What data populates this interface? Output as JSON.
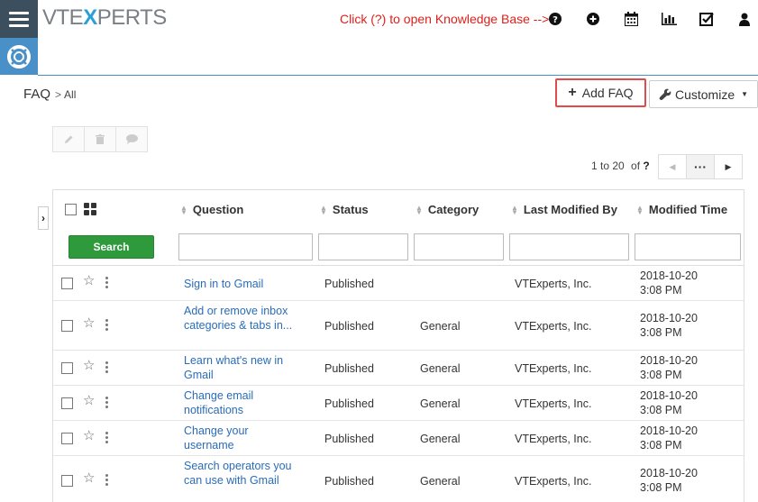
{
  "header": {
    "logo_text_a": "VTE",
    "logo_text_x": "X",
    "logo_text_b": "PERTS",
    "kb_hint": "Click (?) to open Knowledge Base -->",
    "icons": [
      "help-icon",
      "plus-circle-icon",
      "calendar-icon",
      "bar-chart-icon",
      "checkbox-icon",
      "user-icon"
    ]
  },
  "breadcrumb": {
    "module": "FAQ",
    "separator": ">",
    "view": "All"
  },
  "toolbar": {
    "add_label": "Add FAQ",
    "customize_label": "Customize"
  },
  "pager": {
    "range": "1 to 20",
    "of": "of",
    "total": "?"
  },
  "table": {
    "columns": [
      "Question",
      "Status",
      "Category",
      "Last Modified By",
      "Modified Time"
    ],
    "search_label": "Search",
    "rows": [
      {
        "question": "Sign in to Gmail",
        "status": "Published",
        "category": "",
        "modified_by": "VTExperts, Inc.",
        "modified_date": "2018-10-20",
        "modified_time": "3:08 PM"
      },
      {
        "question": "Add or remove inbox categories & tabs in...",
        "status": "Published",
        "category": "General",
        "modified_by": "VTExperts, Inc.",
        "modified_date": "2018-10-20",
        "modified_time": "3:08 PM"
      },
      {
        "question": "Learn what's new in Gmail",
        "status": "Published",
        "category": "General",
        "modified_by": "VTExperts, Inc.",
        "modified_date": "2018-10-20",
        "modified_time": "3:08 PM"
      },
      {
        "question": "Change email notifications",
        "status": "Published",
        "category": "General",
        "modified_by": "VTExperts, Inc.",
        "modified_date": "2018-10-20",
        "modified_time": "3:08 PM"
      },
      {
        "question": "Change your username",
        "status": "Published",
        "category": "General",
        "modified_by": "VTExperts, Inc.",
        "modified_date": "2018-10-20",
        "modified_time": "3:08 PM"
      },
      {
        "question": "Search operators you can use with Gmail",
        "status": "Published",
        "category": "General",
        "modified_by": "VTExperts, Inc.",
        "modified_date": "2018-10-20",
        "modified_time": "3:08 PM"
      }
    ]
  },
  "colors": {
    "accent": "#4a90c8",
    "search_green": "#2e9a3c",
    "hint_red": "#e0201b",
    "link_blue": "#2a6cb8"
  }
}
